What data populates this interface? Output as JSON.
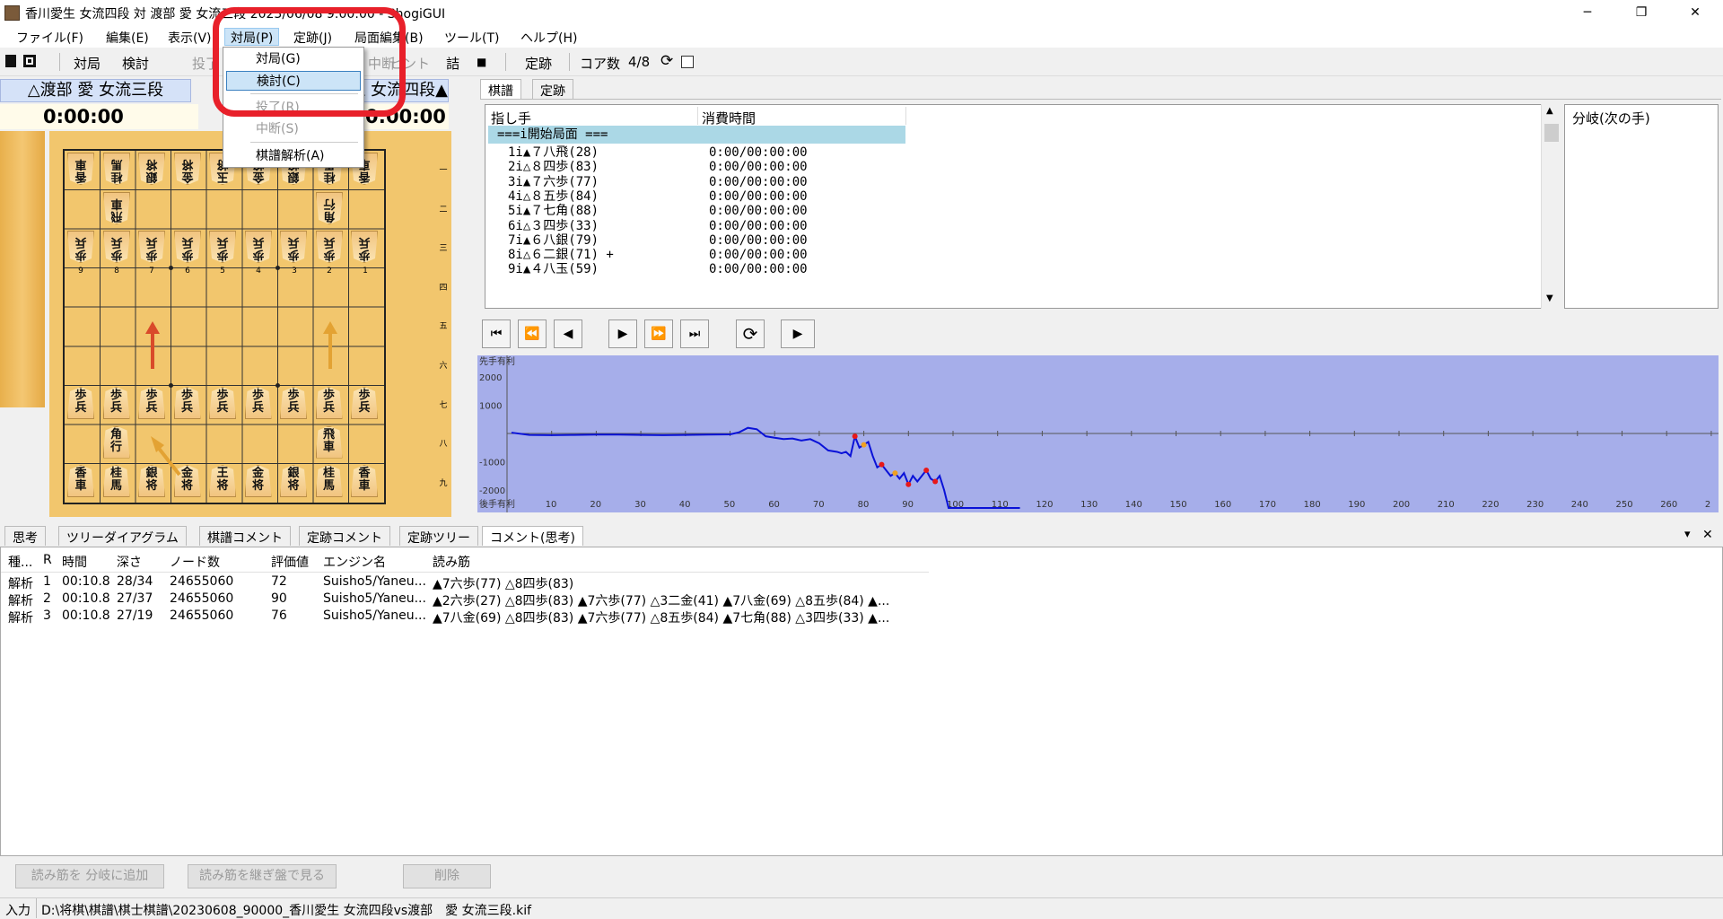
{
  "window": {
    "title": "香川愛生 女流四段 対 渡部 愛 女流三段 2023/06/08 9:00:00 - ShogiGUI",
    "minimize": "─",
    "maximize": "❐",
    "close": "✕"
  },
  "menubar": [
    "ファイル(F)",
    "編集(E)",
    "表示(V)",
    "対局(P)",
    "定跡(J)",
    "局面編集(B)",
    "ツール(T)",
    "ヘルプ(H)"
  ],
  "toolbar": {
    "items": [
      "対局",
      "検討",
      "投了",
      "中断",
      "ヒント",
      "詰",
      "■",
      "定跡",
      "コア数",
      "4/8"
    ]
  },
  "dropdown": {
    "items": [
      {
        "label": "対局(G)",
        "state": "normal"
      },
      {
        "label": "検討(C)",
        "state": "selected"
      },
      {
        "label": "投了(R)",
        "state": "disabled"
      },
      {
        "label": "中断(S)",
        "state": "disabled"
      },
      {
        "label": "棋譜解析(A)",
        "state": "normal"
      }
    ]
  },
  "players": {
    "gote": "△渡部 愛 女流三段",
    "sente": "▲香川愛生 女流四段",
    "gote_time": "0:00:00",
    "sente_time": "0:00:00"
  },
  "board": {
    "col_labels": [
      "9",
      "8",
      "7",
      "6",
      "5",
      "4",
      "3",
      "2",
      "1"
    ],
    "row_labels": [
      "一",
      "二",
      "三",
      "四",
      "五",
      "六",
      "七",
      "八",
      "九"
    ],
    "gote_pieces": [
      [
        "香",
        "車"
      ],
      [
        "桂",
        "馬"
      ],
      [
        "銀",
        "将"
      ],
      [
        "金",
        "将"
      ],
      [
        "玉",
        "将"
      ],
      [
        "金",
        "将"
      ],
      [
        "銀",
        "将"
      ],
      [
        "桂",
        "馬"
      ],
      [
        "香",
        "車"
      ]
    ],
    "gote_rook": [
      "飛",
      "車"
    ],
    "gote_bishop": [
      "角",
      "行"
    ],
    "pawn": [
      "歩",
      "兵"
    ],
    "sente_back": [
      [
        "香",
        "車"
      ],
      [
        "桂",
        "馬"
      ],
      [
        "銀",
        "将"
      ],
      [
        "金",
        "将"
      ],
      [
        "王",
        "将"
      ],
      [
        "金",
        "将"
      ],
      [
        "銀",
        "将"
      ],
      [
        "桂",
        "馬"
      ],
      [
        "香",
        "車"
      ]
    ],
    "sente_bishop": [
      "角",
      "行"
    ],
    "sente_rook": [
      "飛",
      "車"
    ]
  },
  "kifu": {
    "tabs": [
      "棋譜",
      "定跡"
    ],
    "col_move": "指し手",
    "col_time": "消費時間",
    "start": "===i開始局面 ===",
    "rows": [
      {
        "move": "1i▲７八飛(28)",
        "time": "0:00/00:00:00"
      },
      {
        "move": "2i△８四歩(83)",
        "time": "0:00/00:00:00"
      },
      {
        "move": "3i▲７六歩(77)",
        "time": "0:00/00:00:00"
      },
      {
        "move": "4i△８五歩(84)",
        "time": "0:00/00:00:00"
      },
      {
        "move": "5i▲７七角(88)",
        "time": "0:00/00:00:00"
      },
      {
        "move": "6i△３四歩(33)",
        "time": "0:00/00:00:00"
      },
      {
        "move": "7i▲６八銀(79)",
        "time": "0:00/00:00:00"
      },
      {
        "move": "8i△６二銀(71) +",
        "time": "0:00/00:00:00"
      },
      {
        "move": "9i▲４八玉(59)",
        "time": "0:00/00:00:00"
      }
    ],
    "branch_header": "分岐(次の手)"
  },
  "nav": {
    "buttons": [
      "⏮",
      "⏪",
      "◀",
      "▶",
      "⏩",
      "⏭",
      "⟳",
      "▶"
    ]
  },
  "chart_data": {
    "type": "line",
    "title": "",
    "ylabel_top": "先手有利",
    "ylabel_bottom": "後手有利",
    "ylim": [
      -2800,
      2800
    ],
    "y_ticks": [
      "2000",
      "1000",
      "-1000",
      "-2000"
    ],
    "x_ticks": [
      "10",
      "20",
      "30",
      "40",
      "50",
      "60",
      "70",
      "80",
      "90",
      "100",
      "110",
      "120",
      "130",
      "140",
      "150",
      "160",
      "170",
      "180",
      "190",
      "200",
      "210",
      "220",
      "230",
      "240",
      "250",
      "260",
      "2"
    ],
    "x": [
      1,
      5,
      10,
      15,
      20,
      25,
      30,
      35,
      40,
      45,
      50,
      52,
      54,
      56,
      58,
      60,
      62,
      64,
      66,
      68,
      70,
      72,
      74,
      75,
      76,
      77,
      78,
      79,
      80,
      81,
      82,
      83,
      84,
      85,
      86,
      87,
      88,
      89,
      90,
      91,
      92,
      93,
      94,
      95,
      96,
      97,
      98,
      99,
      100,
      101,
      102,
      103,
      105,
      110,
      115
    ],
    "values": [
      30,
      -50,
      -60,
      -50,
      -40,
      -40,
      -50,
      -60,
      -50,
      -40,
      -30,
      40,
      200,
      150,
      -100,
      -150,
      -200,
      -180,
      -250,
      -200,
      -350,
      -600,
      -650,
      -700,
      -650,
      -800,
      -100,
      -500,
      -400,
      -300,
      -800,
      -1200,
      -1100,
      -1300,
      -1500,
      -1400,
      -1600,
      -1400,
      -1800,
      -1500,
      -1700,
      -1500,
      -1300,
      -1600,
      -1700,
      -1500,
      -2000,
      -2800,
      -2800,
      -2800,
      -2800,
      -2800,
      -2800,
      -2800,
      -2800
    ],
    "series_color": "#0a12d8",
    "marker_colors": [
      "#e81818",
      "#f0a020"
    ],
    "grid": true
  },
  "bottom_tabs": [
    "思考",
    "ツリーダイアグラム",
    "棋譜コメント",
    "定跡コメント",
    "定跡ツリー",
    "コメント(思考)"
  ],
  "bottom_tab_controls": {
    "dropdown": "▾",
    "close": "✕"
  },
  "analysis": {
    "headers": [
      "種...",
      "R",
      "時間",
      "深さ",
      "ノード数",
      "評価値",
      "エンジン名",
      "読み筋"
    ],
    "rows": [
      [
        "解析",
        "1",
        "00:10.8",
        "28/34",
        "24655060",
        "72",
        "Suisho5/Yaneu...",
        "▲7六歩(77) △8四歩(83)"
      ],
      [
        "解析",
        "2",
        "00:10.8",
        "27/37",
        "24655060",
        "90",
        "Suisho5/Yaneu...",
        "▲2六歩(27) △8四歩(83) ▲7六歩(77) △3二金(41) ▲7八金(69) △8五歩(84) ▲..."
      ],
      [
        "解析",
        "3",
        "00:10.8",
        "27/19",
        "24655060",
        "76",
        "Suisho5/Yaneu...",
        "▲7八金(69) △8四歩(83) ▲7六歩(77) △8五歩(84) ▲7七角(88) △3四歩(33) ▲..."
      ]
    ]
  },
  "bottom_buttons": [
    "読み筋を 分岐に追加",
    "読み筋を継ぎ盤で見る",
    "削除"
  ],
  "status": {
    "label": "入力",
    "path": "D:\\将棋\\棋譜\\棋士棋譜\\20230608_90000_香川愛生 女流四段vs渡部　愛 女流三段.kif"
  }
}
